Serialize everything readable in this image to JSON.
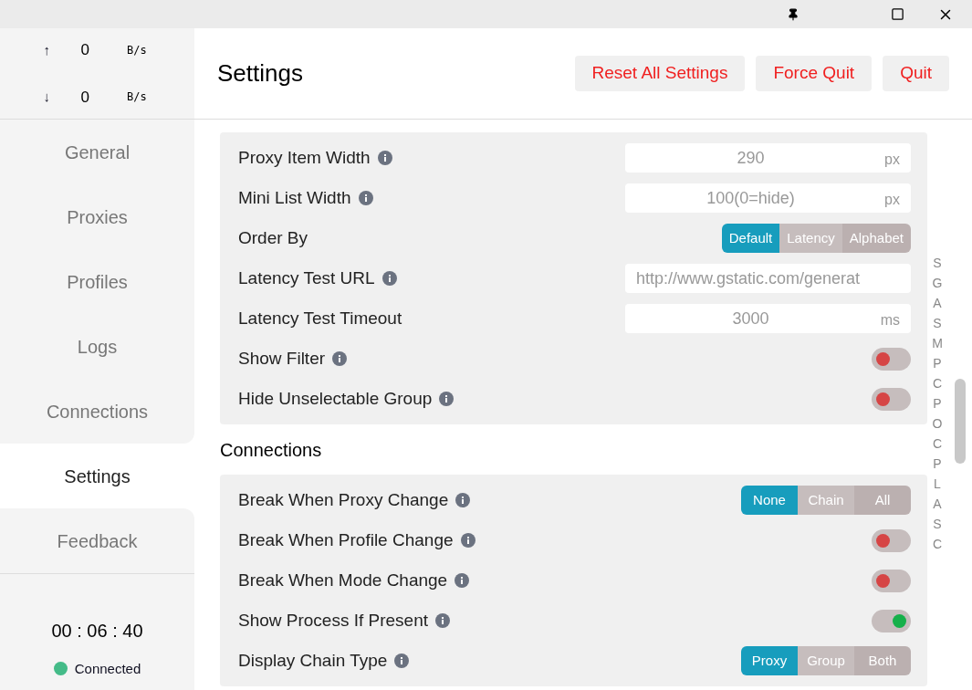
{
  "traffic": [
    {
      "arrow": "↑",
      "value": "0",
      "unit": "B/s"
    },
    {
      "arrow": "↓",
      "value": "0",
      "unit": "B/s"
    }
  ],
  "sidebar": {
    "items": [
      {
        "label": "General",
        "selected": false
      },
      {
        "label": "Proxies",
        "selected": false
      },
      {
        "label": "Profiles",
        "selected": false
      },
      {
        "label": "Logs",
        "selected": false
      },
      {
        "label": "Connections",
        "selected": false
      },
      {
        "label": "Settings",
        "selected": true
      },
      {
        "label": "Feedback",
        "selected": false
      }
    ]
  },
  "uptime": "00 : 06 : 40",
  "status": {
    "label": "Connected",
    "color": "#44bb88"
  },
  "header": {
    "title": "Settings",
    "buttons": [
      "Reset All Settings",
      "Force Quit",
      "Quit"
    ]
  },
  "sections": [
    {
      "rows": [
        {
          "kind": "field",
          "label": "Proxy Item Width",
          "info": true,
          "placeholder": "290",
          "unit": "px"
        },
        {
          "kind": "field",
          "label": "Mini List Width",
          "info": true,
          "placeholder": "100(0=hide)",
          "unit": "px"
        },
        {
          "kind": "segmented",
          "label": "Order By",
          "info": false,
          "options": [
            {
              "label": "Default",
              "selected": true
            },
            {
              "label": "Latency",
              "selected": false
            },
            {
              "label": "Alphabet",
              "selected": false
            }
          ]
        },
        {
          "kind": "field",
          "label": "Latency Test URL",
          "info": true,
          "placeholder": "http://www.gstatic.com/generat"
        },
        {
          "kind": "field",
          "label": "Latency Test Timeout",
          "info": false,
          "placeholder": "3000",
          "unit": "ms"
        },
        {
          "kind": "toggle",
          "label": "Show Filter",
          "info": true,
          "on": false
        },
        {
          "kind": "toggle",
          "label": "Hide Unselectable Group",
          "info": true,
          "on": false
        }
      ]
    },
    {
      "title": "Connections",
      "rows": [
        {
          "kind": "segmented",
          "label": "Break When Proxy Change",
          "info": true,
          "options": [
            {
              "label": "None",
              "selected": true
            },
            {
              "label": "Chain",
              "selected": false
            },
            {
              "label": "All",
              "selected": false
            }
          ]
        },
        {
          "kind": "toggle",
          "label": "Break When Profile Change",
          "info": true,
          "on": false
        },
        {
          "kind": "toggle",
          "label": "Break When Mode Change",
          "info": true,
          "on": false
        },
        {
          "kind": "toggle",
          "label": "Show Process If Present",
          "info": true,
          "on": true
        },
        {
          "kind": "segmented",
          "label": "Display Chain Type",
          "info": true,
          "options": [
            {
              "label": "Proxy",
              "selected": true
            },
            {
              "label": "Group",
              "selected": false
            },
            {
              "label": "Both",
              "selected": false
            }
          ]
        }
      ]
    }
  ],
  "index_letters": [
    "S",
    "G",
    "A",
    "S",
    "M",
    "P",
    "C",
    "P",
    "O",
    "C",
    "P",
    "L",
    "A",
    "S",
    "C"
  ]
}
